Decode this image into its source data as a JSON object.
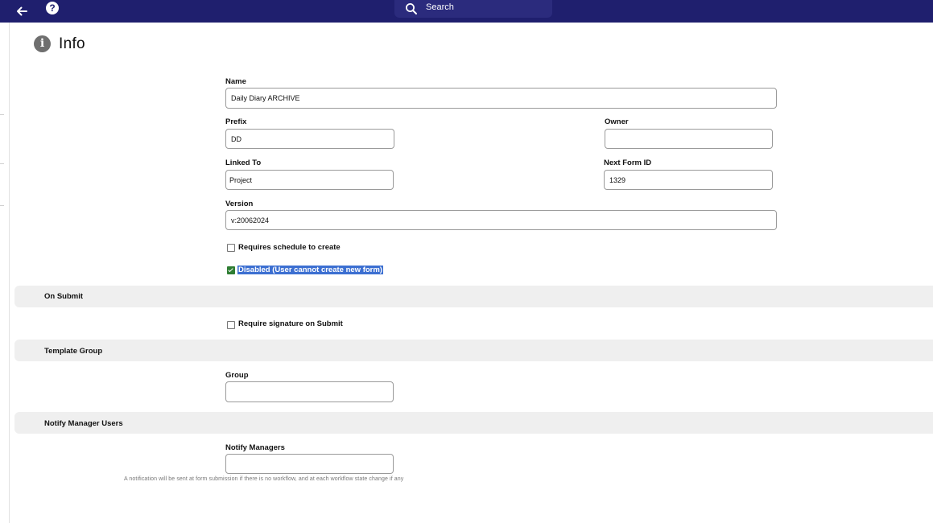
{
  "header": {
    "search_placeholder": "Search"
  },
  "page": {
    "title": "Info"
  },
  "form": {
    "name": {
      "label": "Name",
      "value": "Daily Diary ARCHIVE"
    },
    "prefix": {
      "label": "Prefix",
      "value": "DD"
    },
    "owner": {
      "label": "Owner",
      "value": ""
    },
    "linked_to": {
      "label": "Linked To",
      "value": "Project"
    },
    "next_form_id": {
      "label": "Next Form ID",
      "value": "1329"
    },
    "version": {
      "label": "Version",
      "value": "v:20062024"
    },
    "requires_schedule": {
      "label": "Requires schedule to create",
      "checked": false
    },
    "disabled": {
      "label": "Disabled (User cannot create new form)",
      "checked": true
    }
  },
  "sections": {
    "on_submit": {
      "title": "On Submit",
      "require_signature": {
        "label": "Require signature on Submit",
        "checked": false
      }
    },
    "template_group": {
      "title": "Template Group",
      "group": {
        "label": "Group",
        "value": ""
      }
    },
    "notify_manager_users": {
      "title": "Notify Manager Users",
      "notify_managers": {
        "label": "Notify Managers",
        "value": ""
      },
      "note": "A notification will be sent at form submission if there is no workflow, and at each workflow state change if any"
    }
  },
  "colors": {
    "topbar": "#1f1f6e",
    "section_bg": "#efefef",
    "checkbox_checked": "#2e7d32",
    "selection_highlight": "#3c6fd1"
  }
}
